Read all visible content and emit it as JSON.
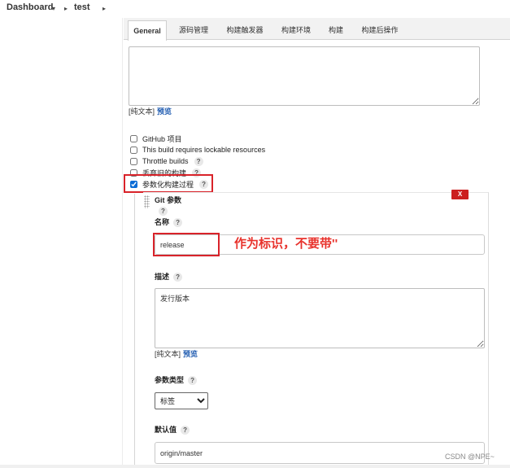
{
  "breadcrumb": {
    "items": [
      "Dashboard",
      "test"
    ],
    "dropdown_icon": "▾",
    "separator_icon": "▸"
  },
  "tabs": [
    {
      "label": "General",
      "active": true
    },
    {
      "label": "源码管理",
      "active": false
    },
    {
      "label": "构建触发器",
      "active": false
    },
    {
      "label": "构建环境",
      "active": false
    },
    {
      "label": "构建",
      "active": false
    },
    {
      "label": "构建后操作",
      "active": false
    }
  ],
  "description": {
    "format_label": "[纯文本]",
    "preview_link": "预览"
  },
  "help_icon": "?",
  "options": [
    {
      "label": "GitHub 项目",
      "checked": false
    },
    {
      "label": "This build requires lockable resources",
      "checked": false
    },
    {
      "label": "Throttle builds",
      "checked": false
    },
    {
      "label": "丢弃旧的构建",
      "checked": false
    },
    {
      "label": "参数化构建过程",
      "checked": true
    }
  ],
  "parameter": {
    "title": "Git 参数",
    "delete_label": "X",
    "name": {
      "label": "名称",
      "value": "release"
    },
    "description": {
      "label": "描述",
      "value": "发行版本",
      "format_label": "[纯文本]",
      "preview_link": "预览"
    },
    "type": {
      "label": "参数类型",
      "selected": "标签"
    },
    "default_value": {
      "label": "默认值",
      "value": "origin/master"
    }
  },
  "annotation": {
    "text": "作为标识，不要带''"
  },
  "watermark": "CSDN @NPE~",
  "colors": {
    "link": "#1f5bb0",
    "highlight": "#d9232a",
    "delete_button": "#cc1f1f",
    "annotation": "#e8322c",
    "checkbox": "#0a6cd6",
    "tab_bar": "#f2f2f2"
  }
}
